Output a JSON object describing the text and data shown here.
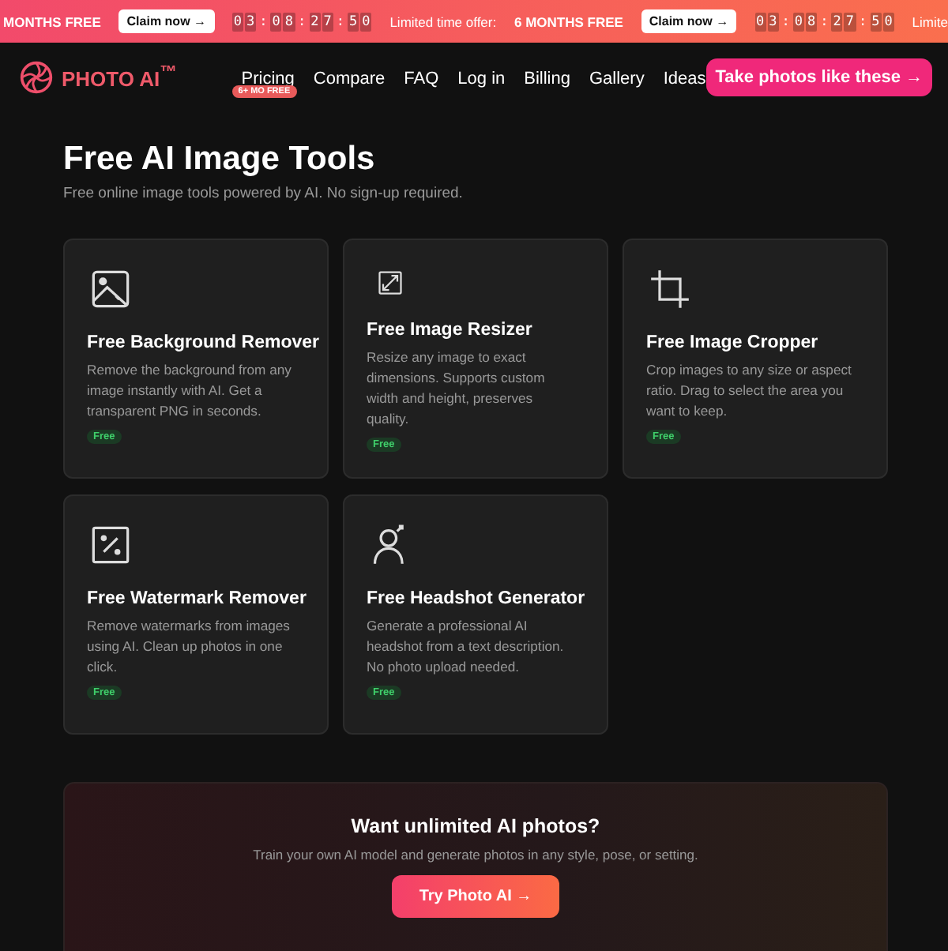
{
  "banner": [
    {
      "kind": "text",
      "text": "MONTHS FREE",
      "bold": true
    },
    {
      "kind": "button",
      "text": "Claim now →"
    },
    {
      "kind": "timer",
      "chars": [
        "0",
        "3",
        ":",
        "0",
        "8",
        ":",
        "2",
        "7",
        ":",
        "5",
        "0"
      ]
    },
    {
      "kind": "text",
      "text": "Limited time offer:",
      "bold": false
    },
    {
      "kind": "text",
      "text": "6 MONTHS FREE",
      "bold": true
    },
    {
      "kind": "button",
      "text": "Claim now →"
    },
    {
      "kind": "timer",
      "chars": [
        "0",
        "3",
        ":",
        "0",
        "8",
        ":",
        "2",
        "7",
        ":",
        "5",
        "0"
      ]
    },
    {
      "kind": "text",
      "text": "Limite",
      "bold": false
    }
  ],
  "logo": {
    "text": "PHOTO AI$^{™}$"
  },
  "nav": [
    {
      "label": "Pricing",
      "badge": "6+ MO FREE"
    },
    {
      "label": "Compare"
    },
    {
      "label": "FAQ"
    },
    {
      "label": "Log in"
    },
    {
      "label": "Billing"
    },
    {
      "label": "Gallery"
    },
    {
      "label": "Ideas"
    }
  ],
  "nav_button": "Take photos like these →",
  "title": "Free AI Image Tools",
  "subtitle": "Free online image tools powered by AI. No sign-up required.",
  "tools": [
    {
      "kind": "image",
      "title": "Free Background Remover",
      "description": "Remove the background from any image instantly with AI. Get a transparent PNG in seconds.",
      "badge": "Free"
    },
    {
      "kind": "resize",
      "title": "Free Image Resizer",
      "description": "Resize any image to exact dimensions. Supports custom width and height, preserves quality.",
      "badge": "Free"
    },
    {
      "kind": "crop",
      "title": "Free Image Cropper",
      "description": "Crop images to any size or aspect ratio. Drag to select the area you want to keep.",
      "badge": "Free"
    },
    {
      "kind": "watermark",
      "title": "Free Watermark Remover",
      "description": "Remove watermarks from images using AI. Clean up photos in one click.",
      "badge": "Free"
    },
    {
      "kind": "person",
      "title": "Free Headshot Generator",
      "description": "Generate a professional AI headshot from a text description. No photo upload needed.",
      "badge": "Free"
    }
  ],
  "cta": {
    "title": "Want unlimited AI photos?",
    "text": "Train your own AI model and generate photos in any style, pose, or setting.",
    "button": "Try Photo AI →"
  }
}
